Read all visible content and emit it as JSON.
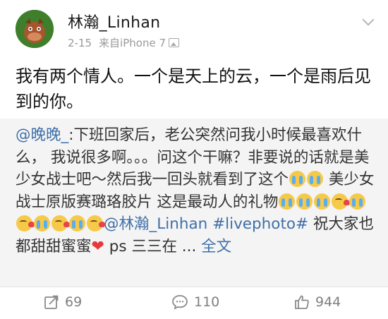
{
  "header": {
    "username": "林瀚_Linhan",
    "date": "2-15",
    "source": "来自iPhone 7"
  },
  "post": {
    "text": "我有两个情人。一个是天上的云，一个是雨后见到的你。"
  },
  "repost": {
    "mention": "@晚晚_",
    "segment1": ":下班回家后，老公突然问我小时候最喜欢什么， 我说很多啊。。。问这个干嘛？非要说的话就是美少女战士吧～然后我一回头就看到了这个",
    "segment2": " 美少女战士原版赛璐珞胶片 这是最动人的礼物",
    "mention2": "@林瀚_Linhan",
    "hashtag": "#livephoto#",
    "segment3": " 祝大家也都甜甜蜜蜜",
    "segment4": " ps 三三在 ... ",
    "more_link": "全文"
  },
  "actions": {
    "repost_count": "69",
    "comment_count": "110",
    "like_count": "944"
  },
  "colors": {
    "link": "#3f6fa8",
    "repost_bg": "#f4f4f4",
    "heart": "#e5393d"
  }
}
